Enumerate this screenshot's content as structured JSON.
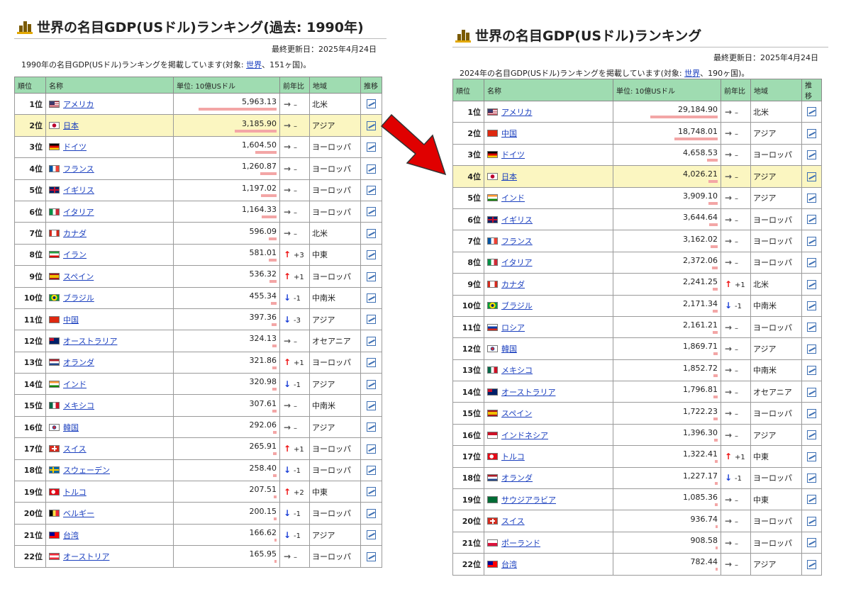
{
  "left": {
    "title": "世界の名目GDP(USドル)ランキング(過去: 1990年)",
    "updated": "最終更新日：2025年4月24日",
    "desc_pre": "1990年の名目GDP(USドル)ランキングを掲載しています(対象: ",
    "desc_link": "世界",
    "desc_post": "、151ヶ国)。",
    "headers": [
      "順位",
      "名称",
      "単位: 10億USドル",
      "前年比",
      "地域",
      "推移"
    ],
    "highlight": 1,
    "max": 5963.13,
    "rows": [
      {
        "rank": "1位",
        "flag": "us",
        "name": "アメリカ",
        "value": "5,963.13",
        "num": 5963.13,
        "dir": "same",
        "change": "–",
        "region": "北米"
      },
      {
        "rank": "2位",
        "flag": "jp",
        "name": "日本",
        "value": "3,185.90",
        "num": 3185.9,
        "dir": "same",
        "change": "–",
        "region": "アジア"
      },
      {
        "rank": "3位",
        "flag": "de",
        "name": "ドイツ",
        "value": "1,604.50",
        "num": 1604.5,
        "dir": "same",
        "change": "–",
        "region": "ヨーロッパ"
      },
      {
        "rank": "4位",
        "flag": "fr",
        "name": "フランス",
        "value": "1,260.87",
        "num": 1260.87,
        "dir": "same",
        "change": "–",
        "region": "ヨーロッパ"
      },
      {
        "rank": "5位",
        "flag": "gb",
        "name": "イギリス",
        "value": "1,197.02",
        "num": 1197.02,
        "dir": "same",
        "change": "–",
        "region": "ヨーロッパ"
      },
      {
        "rank": "6位",
        "flag": "it",
        "name": "イタリア",
        "value": "1,164.33",
        "num": 1164.33,
        "dir": "same",
        "change": "–",
        "region": "ヨーロッパ"
      },
      {
        "rank": "7位",
        "flag": "ca",
        "name": "カナダ",
        "value": "596.09",
        "num": 596.09,
        "dir": "same",
        "change": "–",
        "region": "北米"
      },
      {
        "rank": "8位",
        "flag": "ir",
        "name": "イラン",
        "value": "581.01",
        "num": 581.01,
        "dir": "up",
        "change": "+3",
        "region": "中東"
      },
      {
        "rank": "9位",
        "flag": "es",
        "name": "スペイン",
        "value": "536.32",
        "num": 536.32,
        "dir": "up",
        "change": "+1",
        "region": "ヨーロッパ"
      },
      {
        "rank": "10位",
        "flag": "br",
        "name": "ブラジル",
        "value": "455.34",
        "num": 455.34,
        "dir": "down",
        "change": "-1",
        "region": "中南米"
      },
      {
        "rank": "11位",
        "flag": "cn",
        "name": "中国",
        "value": "397.36",
        "num": 397.36,
        "dir": "down",
        "change": "-3",
        "region": "アジア"
      },
      {
        "rank": "12位",
        "flag": "au",
        "name": "オーストラリア",
        "value": "324.13",
        "num": 324.13,
        "dir": "same",
        "change": "–",
        "region": "オセアニア"
      },
      {
        "rank": "13位",
        "flag": "nl",
        "name": "オランダ",
        "value": "321.86",
        "num": 321.86,
        "dir": "up",
        "change": "+1",
        "region": "ヨーロッパ"
      },
      {
        "rank": "14位",
        "flag": "in",
        "name": "インド",
        "value": "320.98",
        "num": 320.98,
        "dir": "down",
        "change": "-1",
        "region": "アジア"
      },
      {
        "rank": "15位",
        "flag": "mx",
        "name": "メキシコ",
        "value": "307.61",
        "num": 307.61,
        "dir": "same",
        "change": "–",
        "region": "中南米"
      },
      {
        "rank": "16位",
        "flag": "kr",
        "name": "韓国",
        "value": "292.06",
        "num": 292.06,
        "dir": "same",
        "change": "–",
        "region": "アジア"
      },
      {
        "rank": "17位",
        "flag": "ch",
        "name": "スイス",
        "value": "265.91",
        "num": 265.91,
        "dir": "up",
        "change": "+1",
        "region": "ヨーロッパ"
      },
      {
        "rank": "18位",
        "flag": "se",
        "name": "スウェーデン",
        "value": "258.40",
        "num": 258.4,
        "dir": "down",
        "change": "-1",
        "region": "ヨーロッパ"
      },
      {
        "rank": "19位",
        "flag": "tr",
        "name": "トルコ",
        "value": "207.51",
        "num": 207.51,
        "dir": "up",
        "change": "+2",
        "region": "中東"
      },
      {
        "rank": "20位",
        "flag": "be",
        "name": "ベルギー",
        "value": "200.15",
        "num": 200.15,
        "dir": "down",
        "change": "-1",
        "region": "ヨーロッパ"
      },
      {
        "rank": "21位",
        "flag": "tw",
        "name": "台湾",
        "value": "166.62",
        "num": 166.62,
        "dir": "down",
        "change": "-1",
        "region": "アジア"
      },
      {
        "rank": "22位",
        "flag": "at",
        "name": "オーストリア",
        "value": "165.95",
        "num": 165.95,
        "dir": "same",
        "change": "–",
        "region": "ヨーロッパ"
      }
    ]
  },
  "right": {
    "title": "世界の名目GDP(USドル)ランキング",
    "updated": "最終更新日：2025年4月24日",
    "desc_pre": "2024年の名目GDP(USドル)ランキングを掲載しています(対象: ",
    "desc_link": "世界",
    "desc_post": "、190ヶ国)。",
    "headers": [
      "順位",
      "名称",
      "単位: 10億USドル",
      "前年比",
      "地域",
      "推移"
    ],
    "highlight": 3,
    "max": 29184.9,
    "rows": [
      {
        "rank": "1位",
        "flag": "us",
        "name": "アメリカ",
        "value": "29,184.90",
        "num": 29184.9,
        "dir": "same",
        "change": "–",
        "region": "北米"
      },
      {
        "rank": "2位",
        "flag": "cn",
        "name": "中国",
        "value": "18,748.01",
        "num": 18748.01,
        "dir": "same",
        "change": "–",
        "region": "アジア"
      },
      {
        "rank": "3位",
        "flag": "de",
        "name": "ドイツ",
        "value": "4,658.53",
        "num": 4658.53,
        "dir": "same",
        "change": "–",
        "region": "ヨーロッパ"
      },
      {
        "rank": "4位",
        "flag": "jp",
        "name": "日本",
        "value": "4,026.21",
        "num": 4026.21,
        "dir": "same",
        "change": "–",
        "region": "アジア"
      },
      {
        "rank": "5位",
        "flag": "in",
        "name": "インド",
        "value": "3,909.10",
        "num": 3909.1,
        "dir": "same",
        "change": "–",
        "region": "アジア"
      },
      {
        "rank": "6位",
        "flag": "gb",
        "name": "イギリス",
        "value": "3,644.64",
        "num": 3644.64,
        "dir": "same",
        "change": "–",
        "region": "ヨーロッパ"
      },
      {
        "rank": "7位",
        "flag": "fr",
        "name": "フランス",
        "value": "3,162.02",
        "num": 3162.02,
        "dir": "same",
        "change": "–",
        "region": "ヨーロッパ"
      },
      {
        "rank": "8位",
        "flag": "it",
        "name": "イタリア",
        "value": "2,372.06",
        "num": 2372.06,
        "dir": "same",
        "change": "–",
        "region": "ヨーロッパ"
      },
      {
        "rank": "9位",
        "flag": "ca",
        "name": "カナダ",
        "value": "2,241.25",
        "num": 2241.25,
        "dir": "up",
        "change": "+1",
        "region": "北米"
      },
      {
        "rank": "10位",
        "flag": "br",
        "name": "ブラジル",
        "value": "2,171.34",
        "num": 2171.34,
        "dir": "down",
        "change": "-1",
        "region": "中南米"
      },
      {
        "rank": "11位",
        "flag": "ru",
        "name": "ロシア",
        "value": "2,161.21",
        "num": 2161.21,
        "dir": "same",
        "change": "–",
        "region": "ヨーロッパ"
      },
      {
        "rank": "12位",
        "flag": "kr",
        "name": "韓国",
        "value": "1,869.71",
        "num": 1869.71,
        "dir": "same",
        "change": "–",
        "region": "アジア"
      },
      {
        "rank": "13位",
        "flag": "mx",
        "name": "メキシコ",
        "value": "1,852.72",
        "num": 1852.72,
        "dir": "same",
        "change": "–",
        "region": "中南米"
      },
      {
        "rank": "14位",
        "flag": "au",
        "name": "オーストラリア",
        "value": "1,796.81",
        "num": 1796.81,
        "dir": "same",
        "change": "–",
        "region": "オセアニア"
      },
      {
        "rank": "15位",
        "flag": "es",
        "name": "スペイン",
        "value": "1,722.23",
        "num": 1722.23,
        "dir": "same",
        "change": "–",
        "region": "ヨーロッパ"
      },
      {
        "rank": "16位",
        "flag": "id",
        "name": "インドネシア",
        "value": "1,396.30",
        "num": 1396.3,
        "dir": "same",
        "change": "–",
        "region": "アジア"
      },
      {
        "rank": "17位",
        "flag": "tr",
        "name": "トルコ",
        "value": "1,322.41",
        "num": 1322.41,
        "dir": "up",
        "change": "+1",
        "region": "中東"
      },
      {
        "rank": "18位",
        "flag": "nl",
        "name": "オランダ",
        "value": "1,227.17",
        "num": 1227.17,
        "dir": "down",
        "change": "-1",
        "region": "ヨーロッパ"
      },
      {
        "rank": "19位",
        "flag": "sa",
        "name": "サウジアラビア",
        "value": "1,085.36",
        "num": 1085.36,
        "dir": "same",
        "change": "–",
        "region": "中東"
      },
      {
        "rank": "20位",
        "flag": "ch",
        "name": "スイス",
        "value": "936.74",
        "num": 936.74,
        "dir": "same",
        "change": "–",
        "region": "ヨーロッパ"
      },
      {
        "rank": "21位",
        "flag": "pl",
        "name": "ポーランド",
        "value": "908.58",
        "num": 908.58,
        "dir": "same",
        "change": "–",
        "region": "ヨーロッパ"
      },
      {
        "rank": "22位",
        "flag": "tw",
        "name": "台湾",
        "value": "782.44",
        "num": 782.44,
        "dir": "same",
        "change": "–",
        "region": "アジア"
      }
    ]
  },
  "icons": {
    "title": "ranking-logo-icon",
    "trend": "chart-trend-icon",
    "arrow": "red-arrow"
  },
  "colors": {
    "header_bg": "#9fdcb1",
    "highlight_bg": "#fbf6c1",
    "bar": "#f3a6a6",
    "link": "#1a3fbf",
    "up": "#e11111",
    "down": "#1b3fd6",
    "annotation_arrow": "#e00000"
  }
}
